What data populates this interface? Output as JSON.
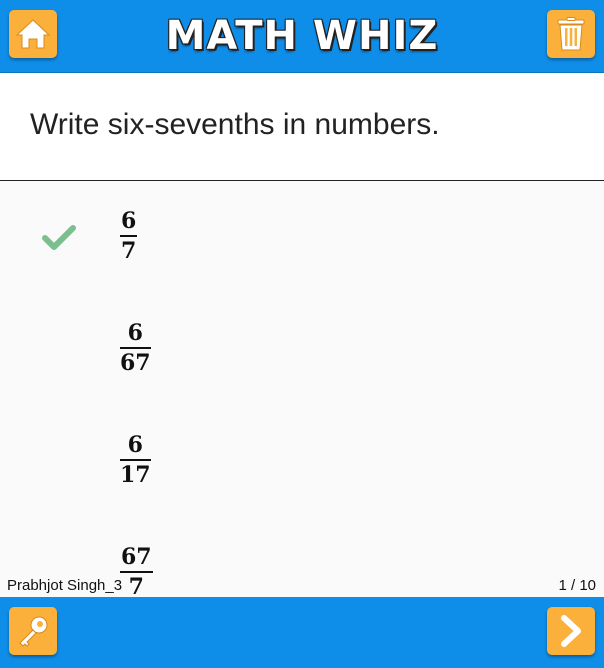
{
  "header": {
    "title": "MATH WHIZ",
    "home_icon": "home-icon",
    "trash_icon": "trash-icon",
    "color": "#0f8ee9",
    "button_color": "#fbb03b"
  },
  "question": {
    "text": "Write six-sevenths in numbers."
  },
  "answers": [
    {
      "numerator": "6",
      "denominator": "7",
      "checked": true
    },
    {
      "numerator": "6",
      "denominator": "67",
      "checked": false
    },
    {
      "numerator": "6",
      "denominator": "17",
      "checked": false
    },
    {
      "numerator": "67",
      "denominator": "7",
      "checked": false
    }
  ],
  "footer": {
    "user": "Prabhjot Singh_3",
    "page": "1 / 10"
  },
  "bottom_bar": {
    "key_icon": "key-icon",
    "next_icon": "chevron-right-icon",
    "check_color": "#7cbf8e"
  }
}
